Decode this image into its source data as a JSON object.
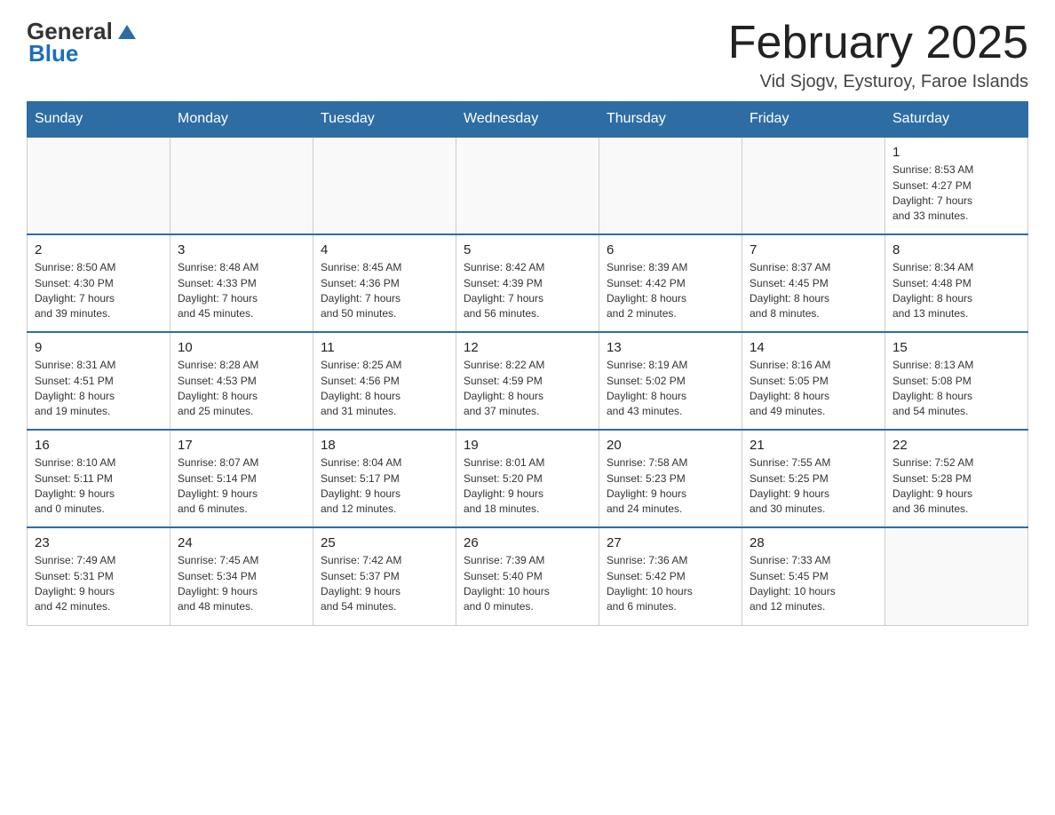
{
  "header": {
    "logo_general": "General",
    "logo_blue": "Blue",
    "month_title": "February 2025",
    "location": "Vid Sjogv, Eysturoy, Faroe Islands"
  },
  "days_of_week": [
    "Sunday",
    "Monday",
    "Tuesday",
    "Wednesday",
    "Thursday",
    "Friday",
    "Saturday"
  ],
  "weeks": [
    {
      "days": [
        {
          "number": "",
          "info": ""
        },
        {
          "number": "",
          "info": ""
        },
        {
          "number": "",
          "info": ""
        },
        {
          "number": "",
          "info": ""
        },
        {
          "number": "",
          "info": ""
        },
        {
          "number": "",
          "info": ""
        },
        {
          "number": "1",
          "info": "Sunrise: 8:53 AM\nSunset: 4:27 PM\nDaylight: 7 hours\nand 33 minutes."
        }
      ]
    },
    {
      "days": [
        {
          "number": "2",
          "info": "Sunrise: 8:50 AM\nSunset: 4:30 PM\nDaylight: 7 hours\nand 39 minutes."
        },
        {
          "number": "3",
          "info": "Sunrise: 8:48 AM\nSunset: 4:33 PM\nDaylight: 7 hours\nand 45 minutes."
        },
        {
          "number": "4",
          "info": "Sunrise: 8:45 AM\nSunset: 4:36 PM\nDaylight: 7 hours\nand 50 minutes."
        },
        {
          "number": "5",
          "info": "Sunrise: 8:42 AM\nSunset: 4:39 PM\nDaylight: 7 hours\nand 56 minutes."
        },
        {
          "number": "6",
          "info": "Sunrise: 8:39 AM\nSunset: 4:42 PM\nDaylight: 8 hours\nand 2 minutes."
        },
        {
          "number": "7",
          "info": "Sunrise: 8:37 AM\nSunset: 4:45 PM\nDaylight: 8 hours\nand 8 minutes."
        },
        {
          "number": "8",
          "info": "Sunrise: 8:34 AM\nSunset: 4:48 PM\nDaylight: 8 hours\nand 13 minutes."
        }
      ]
    },
    {
      "days": [
        {
          "number": "9",
          "info": "Sunrise: 8:31 AM\nSunset: 4:51 PM\nDaylight: 8 hours\nand 19 minutes."
        },
        {
          "number": "10",
          "info": "Sunrise: 8:28 AM\nSunset: 4:53 PM\nDaylight: 8 hours\nand 25 minutes."
        },
        {
          "number": "11",
          "info": "Sunrise: 8:25 AM\nSunset: 4:56 PM\nDaylight: 8 hours\nand 31 minutes."
        },
        {
          "number": "12",
          "info": "Sunrise: 8:22 AM\nSunset: 4:59 PM\nDaylight: 8 hours\nand 37 minutes."
        },
        {
          "number": "13",
          "info": "Sunrise: 8:19 AM\nSunset: 5:02 PM\nDaylight: 8 hours\nand 43 minutes."
        },
        {
          "number": "14",
          "info": "Sunrise: 8:16 AM\nSunset: 5:05 PM\nDaylight: 8 hours\nand 49 minutes."
        },
        {
          "number": "15",
          "info": "Sunrise: 8:13 AM\nSunset: 5:08 PM\nDaylight: 8 hours\nand 54 minutes."
        }
      ]
    },
    {
      "days": [
        {
          "number": "16",
          "info": "Sunrise: 8:10 AM\nSunset: 5:11 PM\nDaylight: 9 hours\nand 0 minutes."
        },
        {
          "number": "17",
          "info": "Sunrise: 8:07 AM\nSunset: 5:14 PM\nDaylight: 9 hours\nand 6 minutes."
        },
        {
          "number": "18",
          "info": "Sunrise: 8:04 AM\nSunset: 5:17 PM\nDaylight: 9 hours\nand 12 minutes."
        },
        {
          "number": "19",
          "info": "Sunrise: 8:01 AM\nSunset: 5:20 PM\nDaylight: 9 hours\nand 18 minutes."
        },
        {
          "number": "20",
          "info": "Sunrise: 7:58 AM\nSunset: 5:23 PM\nDaylight: 9 hours\nand 24 minutes."
        },
        {
          "number": "21",
          "info": "Sunrise: 7:55 AM\nSunset: 5:25 PM\nDaylight: 9 hours\nand 30 minutes."
        },
        {
          "number": "22",
          "info": "Sunrise: 7:52 AM\nSunset: 5:28 PM\nDaylight: 9 hours\nand 36 minutes."
        }
      ]
    },
    {
      "days": [
        {
          "number": "23",
          "info": "Sunrise: 7:49 AM\nSunset: 5:31 PM\nDaylight: 9 hours\nand 42 minutes."
        },
        {
          "number": "24",
          "info": "Sunrise: 7:45 AM\nSunset: 5:34 PM\nDaylight: 9 hours\nand 48 minutes."
        },
        {
          "number": "25",
          "info": "Sunrise: 7:42 AM\nSunset: 5:37 PM\nDaylight: 9 hours\nand 54 minutes."
        },
        {
          "number": "26",
          "info": "Sunrise: 7:39 AM\nSunset: 5:40 PM\nDaylight: 10 hours\nand 0 minutes."
        },
        {
          "number": "27",
          "info": "Sunrise: 7:36 AM\nSunset: 5:42 PM\nDaylight: 10 hours\nand 6 minutes."
        },
        {
          "number": "28",
          "info": "Sunrise: 7:33 AM\nSunset: 5:45 PM\nDaylight: 10 hours\nand 12 minutes."
        },
        {
          "number": "",
          "info": ""
        }
      ]
    }
  ]
}
